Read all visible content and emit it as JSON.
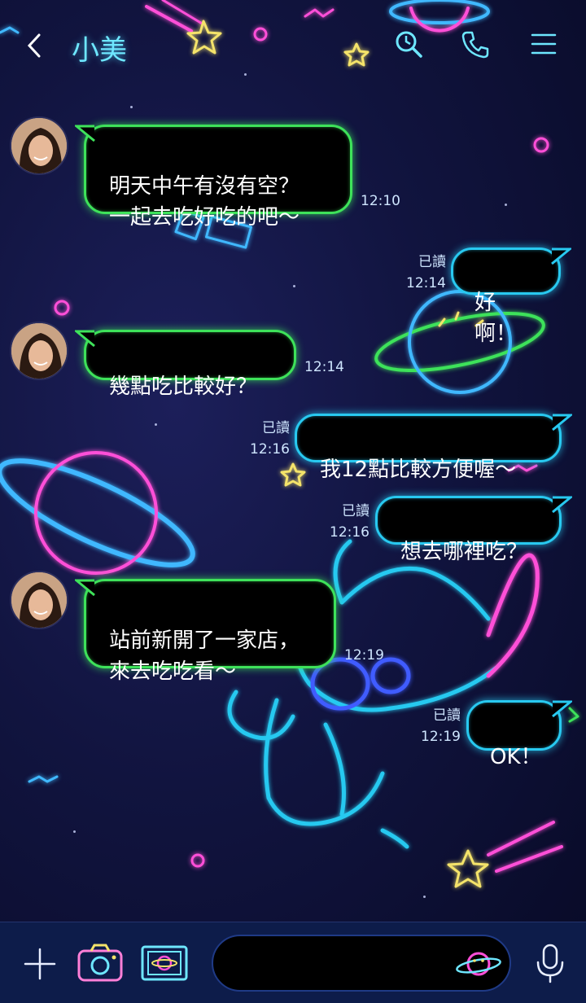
{
  "header": {
    "title": "小美",
    "back_icon": "chevron-left-icon",
    "search_icon": "search-icon",
    "call_icon": "phone-icon",
    "menu_icon": "menu-icon"
  },
  "messages": [
    {
      "side": "in",
      "text": "明天中午有沒有空？\n一起去吃好吃的吧～",
      "time": "12:10"
    },
    {
      "side": "out",
      "text": "好啊！",
      "read": "已讀",
      "time": "12:14"
    },
    {
      "side": "in",
      "text": "幾點吃比較好？",
      "time": "12:14"
    },
    {
      "side": "out",
      "text": "我12點比較方便喔～",
      "read": "已讀",
      "time": "12:16"
    },
    {
      "side": "out",
      "text": "想去哪裡吃？",
      "read": "已讀",
      "time": "12:16"
    },
    {
      "side": "in",
      "text": "站前新開了一家店，\n來去吃吃看～",
      "time": "12:19"
    },
    {
      "side": "out",
      "text": "OK！",
      "read": "已讀",
      "time": "12:19"
    }
  ],
  "input": {
    "placeholder": "",
    "value": ""
  },
  "bottom_icons": [
    "plus-icon",
    "camera-icon",
    "image-icon",
    "planet-sticker-icon",
    "microphone-icon"
  ],
  "colors": {
    "incoming_border": "#3ee25a",
    "outgoing_border": "#28c9f0",
    "title": "#6ee7ff",
    "background": "#11143f",
    "bottom_bar": "#0d1c4a"
  }
}
